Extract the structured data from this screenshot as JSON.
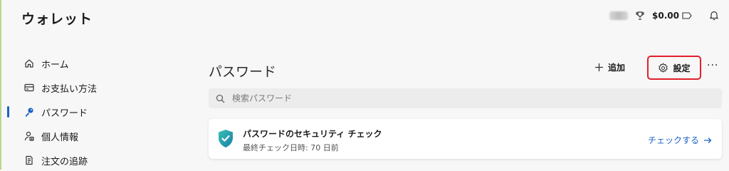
{
  "app": {
    "title": "ウォレット"
  },
  "topbar": {
    "balance": "$0.00"
  },
  "sidebar": {
    "items": [
      {
        "label": "ホーム",
        "icon": "home-icon"
      },
      {
        "label": "お支払い方法",
        "icon": "card-icon"
      },
      {
        "label": "パスワード",
        "icon": "key-icon",
        "active": true
      },
      {
        "label": "個人情報",
        "icon": "person-icon"
      },
      {
        "label": "注文の追跡",
        "icon": "receipt-icon"
      }
    ]
  },
  "main": {
    "title": "パスワード",
    "add_label": "追加",
    "settings_label": "設定",
    "more_label": "···",
    "search": {
      "placeholder": "検索パスワード",
      "value": ""
    },
    "security_card": {
      "title": "パスワードのセキュリティ チェック",
      "subtitle": "最終チェック日時: 70 日前",
      "link_label": "チェックする"
    }
  },
  "colors": {
    "accent": "#1b63c6",
    "highlight_border": "#e0202a",
    "shield": "#1aa0a0"
  }
}
